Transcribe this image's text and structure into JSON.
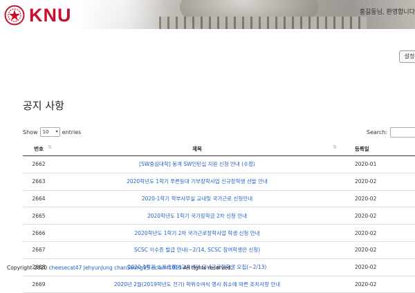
{
  "header": {
    "logo_text": "KNU",
    "greeting": "홍길동님, 환영합니다",
    "settings_label": "설정"
  },
  "page": {
    "title": "공지 사항"
  },
  "table_controls": {
    "show_label": "Show",
    "entries_value": "10",
    "entries_label": "entries",
    "search_label": "Search:"
  },
  "table": {
    "headers": {
      "num": "번호",
      "title": "제목",
      "date": "등록일"
    },
    "rows": [
      {
        "num": "2662",
        "title": "[SW중심대학] 동계 SW인턴십 지원 신청 안내 (수정)",
        "date": "2020-01"
      },
      {
        "num": "2663",
        "title": "2020학년도 1학기 푸른등대 기부장학사업 신규장학생 선발 안내",
        "date": "2020-02"
      },
      {
        "num": "2664",
        "title": "2020-1학기 학부사무실 교내및 국가근로 신청안내",
        "date": "2020-02"
      },
      {
        "num": "2665",
        "title": "2020학년도 1학기 국가장학금 2차 신청 안내",
        "date": "2020-02"
      },
      {
        "num": "2666",
        "title": "2020학년도 1학기 2차 국가근로장학사업 학생 신청 안내",
        "date": "2020-02"
      },
      {
        "num": "2667",
        "title": "SCSC 이수증 발급 안내(~2/14, SCSC 참여학생만 신청)",
        "date": "2020-02"
      },
      {
        "num": "2668",
        "title": "2020-1학기 소프트웨어교육센터 교내근로장학생 모집(~2/13)",
        "date": "2020-02"
      },
      {
        "num": "2669",
        "title": "2020년 2월(2019학년도 전기) 학위수여식 행사 취소에 따른 조치사항 안내",
        "date": "2020-02"
      }
    ]
  },
  "footer": {
    "prefix": "Copyright 2020",
    "names": "cheesecat47 JehyunJung chanSeong95 eclaim1010",
    "suffix": "All rights reserved."
  }
}
